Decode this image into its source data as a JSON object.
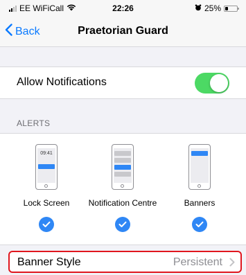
{
  "status_bar": {
    "carrier": "EE WiFiCall",
    "time": "22:26",
    "battery": "25%",
    "battery_level": 0.25
  },
  "nav": {
    "back_label": "Back",
    "title": "Praetorian Guard"
  },
  "notifications": {
    "allow_label": "Allow Notifications",
    "allow_enabled": true
  },
  "alerts": {
    "header": "ALERTS",
    "lock_screen_time": "09:41",
    "options": [
      {
        "label": "Lock Screen",
        "checked": true
      },
      {
        "label": "Notification Centre",
        "checked": true
      },
      {
        "label": "Banners",
        "checked": true
      }
    ]
  },
  "banner_style": {
    "label": "Banner Style",
    "value": "Persistent"
  },
  "colors": {
    "accent": "#0a7aff",
    "toggle_on": "#4cd964",
    "highlight": "#e0161e"
  }
}
